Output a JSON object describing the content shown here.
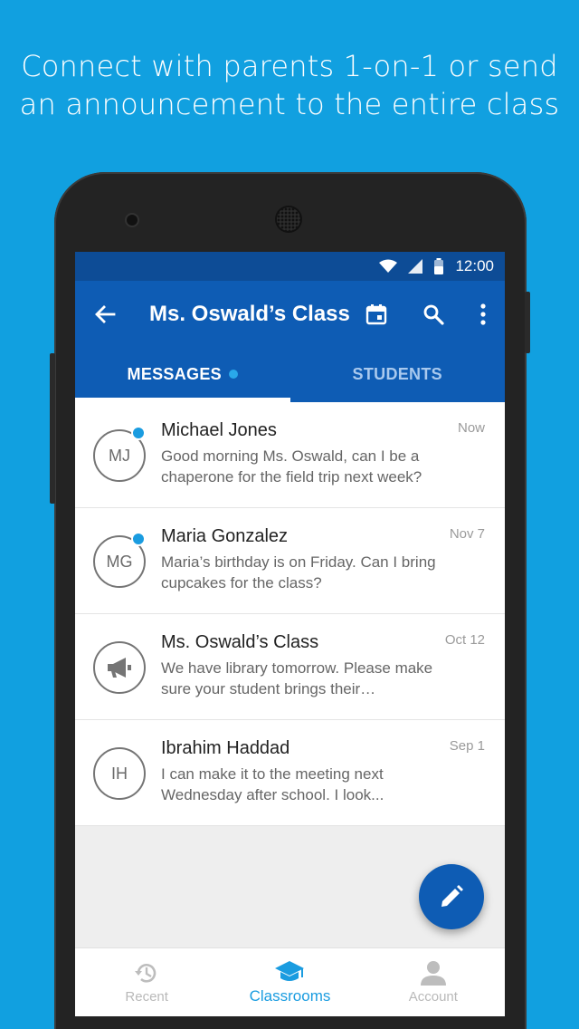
{
  "headline": {
    "line1": "Connect with parents 1-on-1 or send",
    "line2": "an announcement to the entire class"
  },
  "status_bar": {
    "time": "12:00",
    "icons": [
      "wifi-icon",
      "signal-icon",
      "battery-icon"
    ]
  },
  "app_bar": {
    "title": "Ms. Oswald’s Class",
    "actions": [
      "calendar-icon",
      "search-icon",
      "more-vert-icon"
    ]
  },
  "tabs": [
    {
      "label": "MESSAGES",
      "active": true,
      "has_dot": true
    },
    {
      "label": "STUDENTS",
      "active": false,
      "has_dot": false
    }
  ],
  "messages": [
    {
      "initials": "MJ",
      "name": "Michael Jones",
      "time": "Now",
      "preview": "Good morning Ms. Oswald, can I be a chaperone for the field trip next week?",
      "unread": true
    },
    {
      "initials": "MG",
      "name": "Maria Gonzalez",
      "time": "Nov 7",
      "preview": "Maria’s birthday is on Friday. Can I bring cupcakes for the class?",
      "unread": true
    },
    {
      "initials": "",
      "icon": "megaphone-icon",
      "name": "Ms. Oswald’s Class",
      "time": "Oct 12",
      "preview": "We have library tomorrow. Please make sure your student brings their…",
      "unread": false
    },
    {
      "initials": "IH",
      "name": "Ibrahim Haddad",
      "time": "Sep 1",
      "preview": "I can make it to the meeting next Wednesday after school. I look...",
      "unread": false
    }
  ],
  "fab": {
    "icon": "pencil-icon"
  },
  "bottom_nav": [
    {
      "label": "Recent",
      "icon": "history-icon",
      "active": false
    },
    {
      "label": "Classrooms",
      "icon": "graduation-cap-icon",
      "active": true
    },
    {
      "label": "Account",
      "icon": "person-icon",
      "active": false
    }
  ],
  "colors": {
    "background": "#11A0E0",
    "app_bar": "#0E5CB4",
    "status_bar": "#0D4C96",
    "accent": "#1A9CE0"
  }
}
